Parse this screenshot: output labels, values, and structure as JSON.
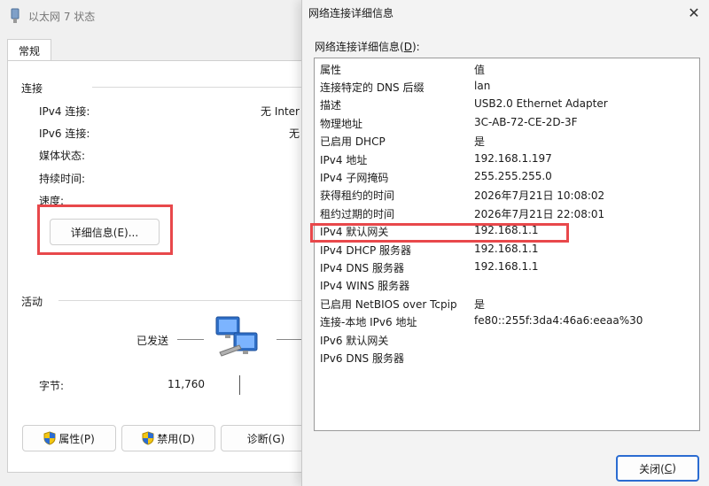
{
  "back_window": {
    "title": "以太网 7 状态",
    "tab": "常规",
    "connection_group": "连接",
    "rows": [
      {
        "label": "IPv4 连接:",
        "value": "无 Inter"
      },
      {
        "label": "IPv6 连接:",
        "value": "无"
      },
      {
        "label": "媒体状态:",
        "value": ""
      },
      {
        "label": "持续时间:",
        "value": ""
      },
      {
        "label": "速度:",
        "value": ""
      }
    ],
    "details_button": "详细信息(E)...",
    "activity_group": "活动",
    "sent_label": "已发送",
    "bytes_label": "字节:",
    "bytes_sent": "11,760",
    "buttons": {
      "properties": "属性(P)",
      "disable": "禁用(D)",
      "diagnose": "诊断(G)"
    }
  },
  "dialog": {
    "title": "网络连接详细信息",
    "close_glyph": "✕",
    "list_label_prefix": "网络连接详细信息(",
    "list_label_key": "D",
    "list_label_suffix": "):",
    "columns": {
      "property": "属性",
      "value": "值"
    },
    "rows": [
      {
        "property": "连接特定的 DNS 后缀",
        "value": "lan"
      },
      {
        "property": "描述",
        "value": "USB2.0 Ethernet Adapter"
      },
      {
        "property": "物理地址",
        "value": "3C-AB-72-CE-2D-3F"
      },
      {
        "property": "已启用 DHCP",
        "value": "是"
      },
      {
        "property": "IPv4 地址",
        "value": "192.168.1.197"
      },
      {
        "property": "IPv4 子网掩码",
        "value": "255.255.255.0"
      },
      {
        "property": "获得租约的时间",
        "value": "2026年7月21日 10:08:02"
      },
      {
        "property": "租约过期的时间",
        "value": "2026年7月21日 22:08:01"
      },
      {
        "property": "IPv4 默认网关",
        "value": "192.168.1.1"
      },
      {
        "property": "IPv4 DHCP 服务器",
        "value": "192.168.1.1"
      },
      {
        "property": "IPv4 DNS 服务器",
        "value": "192.168.1.1"
      },
      {
        "property": "IPv4 WINS 服务器",
        "value": ""
      },
      {
        "property": "已启用 NetBIOS over Tcpip",
        "value": "是"
      },
      {
        "property": "连接-本地 IPv6 地址",
        "value": "fe80::255f:3da4:46a6:eeaa%30"
      },
      {
        "property": "IPv6 默认网关",
        "value": ""
      },
      {
        "property": "IPv6 DNS 服务器",
        "value": ""
      }
    ],
    "close_prefix": "关闭(",
    "close_key": "C",
    "close_suffix": ")"
  },
  "colors": {
    "highlight": "#e8484b",
    "accent": "#2b6cd1"
  }
}
